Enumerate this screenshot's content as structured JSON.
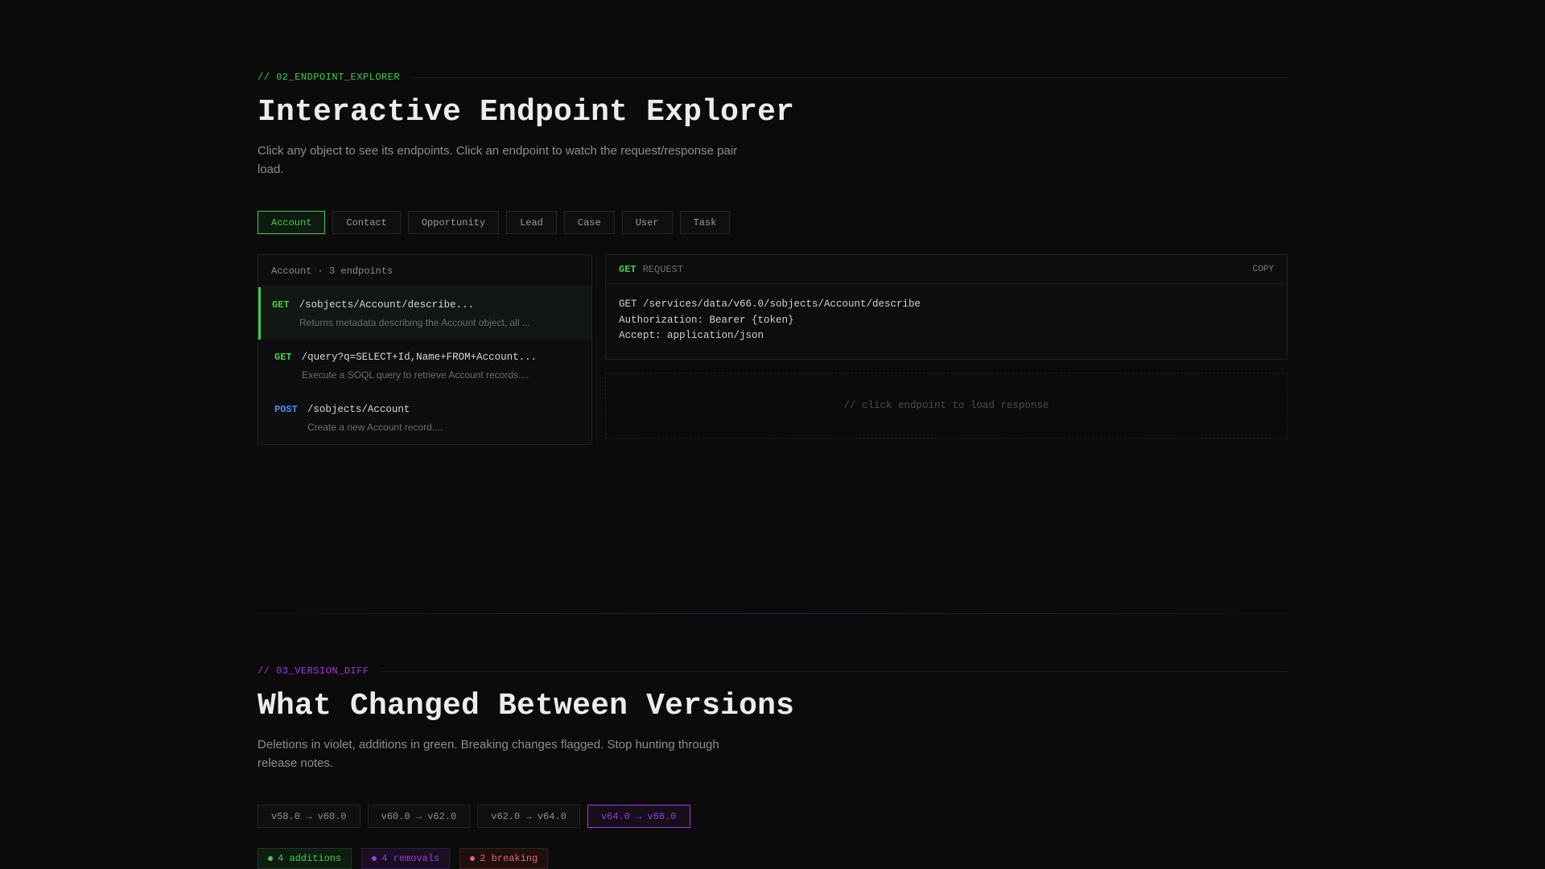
{
  "explorer": {
    "eyebrow": "// 02_ENDPOINT_EXPLORER",
    "title": "Interactive Endpoint Explorer",
    "description": "Click any object to see its endpoints. Click an endpoint to watch the request/response pair load.",
    "objects": [
      "Account",
      "Contact",
      "Opportunity",
      "Lead",
      "Case",
      "User",
      "Task"
    ],
    "active_object": "Account",
    "list_header": "Account · 3 endpoints",
    "endpoints": [
      {
        "method": "GET",
        "path": "/sobjects/Account/describe...",
        "description": "Returns metadata describing the Account object, all ..."
      },
      {
        "method": "GET",
        "path": "/query?q=SELECT+Id,Name+FROM+Account...",
        "description": "Execute a SOQL query to retrieve Account records...."
      },
      {
        "method": "POST",
        "path": "/sobjects/Account",
        "description": "Create a new Account record...."
      }
    ],
    "request": {
      "method": "GET",
      "label": "REQUEST",
      "copy": "COPY",
      "lines": [
        "GET /services/data/v66.0/sobjects/Account/describe",
        "Authorization: Bearer {token}",
        "Accept: application/json"
      ]
    },
    "response_placeholder": "// click endpoint to load response"
  },
  "diff": {
    "eyebrow": "// 03_VERSION_DIFF",
    "title": "What Changed Between Versions",
    "description": "Deletions in violet, additions in green. Breaking changes flagged. Stop hunting through release notes.",
    "versions": [
      "v58.0 → v60.0",
      "v60.0 → v62.0",
      "v62.0 → v64.0",
      "v64.0 → v66.0"
    ],
    "active_version": "v64.0 → v66.0",
    "badges": {
      "additions": "4 additions",
      "removals": "4 removals",
      "breaking": "2 breaking"
    }
  },
  "colors": {
    "accent_green": "#3ccf4e",
    "accent_violet": "#a13ad8",
    "post_blue": "#4c8dff",
    "breaking_red": "#e06a6a",
    "background": "#0b0b0c"
  }
}
